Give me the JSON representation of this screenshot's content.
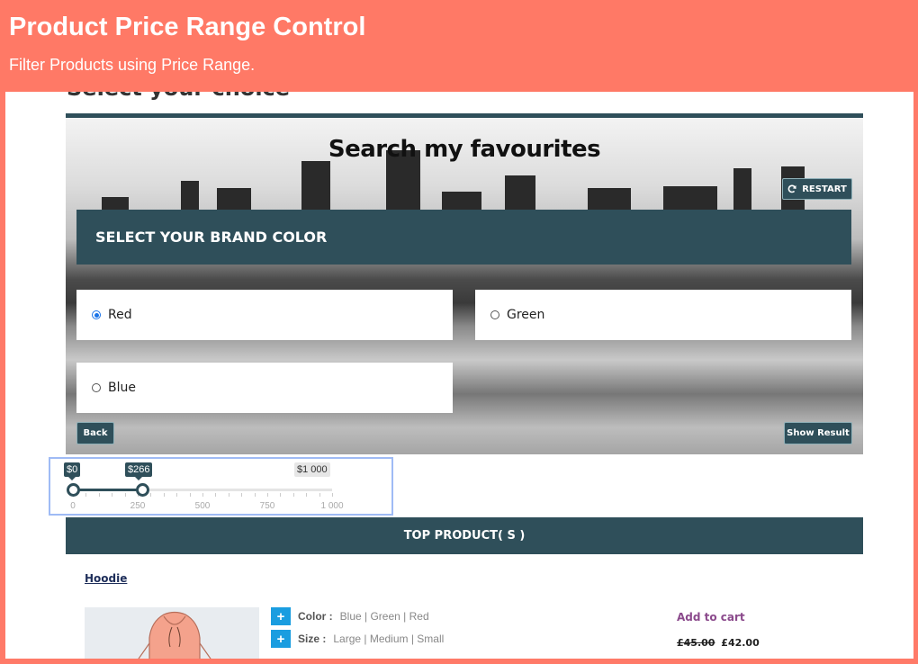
{
  "banner": {
    "title": "Product Price Range Control",
    "subtitle": "Filter Products using Price Range."
  },
  "page": {
    "partial_heading": "Select your choice"
  },
  "quiz": {
    "title": "Search my favourites",
    "restart_label": "RESTART",
    "question": "SELECT YOUR BRAND COLOR",
    "options": [
      {
        "label": "Red",
        "checked": true
      },
      {
        "label": "Green",
        "checked": false
      },
      {
        "label": "Blue",
        "checked": false
      }
    ],
    "back_label": "Back",
    "show_result_label": "Show Result"
  },
  "price_slider": {
    "min_label": "$0",
    "max_value_label": "$266",
    "range_max_label": "$1 000",
    "min": 0,
    "max": 1000,
    "selected_min": 0,
    "selected_max": 266,
    "ticks": [
      "0",
      "250",
      "500",
      "750",
      "1 000"
    ]
  },
  "top_products": {
    "heading": "TOP PRODUCT( S )",
    "product": {
      "name": "Hoodie",
      "attributes": [
        {
          "name": "Color :",
          "value": "Blue | Green | Red"
        },
        {
          "name": "Size :",
          "value": "Large | Medium | Small"
        }
      ],
      "add_to_cart": "Add to cart",
      "old_price": "£45.00",
      "new_price": "£42.00"
    }
  },
  "colors": {
    "banner": "#ff7966",
    "brand_dark": "#2f4f5a",
    "plus_button": "#1a9de0",
    "add_to_cart": "#8b4a8c"
  }
}
